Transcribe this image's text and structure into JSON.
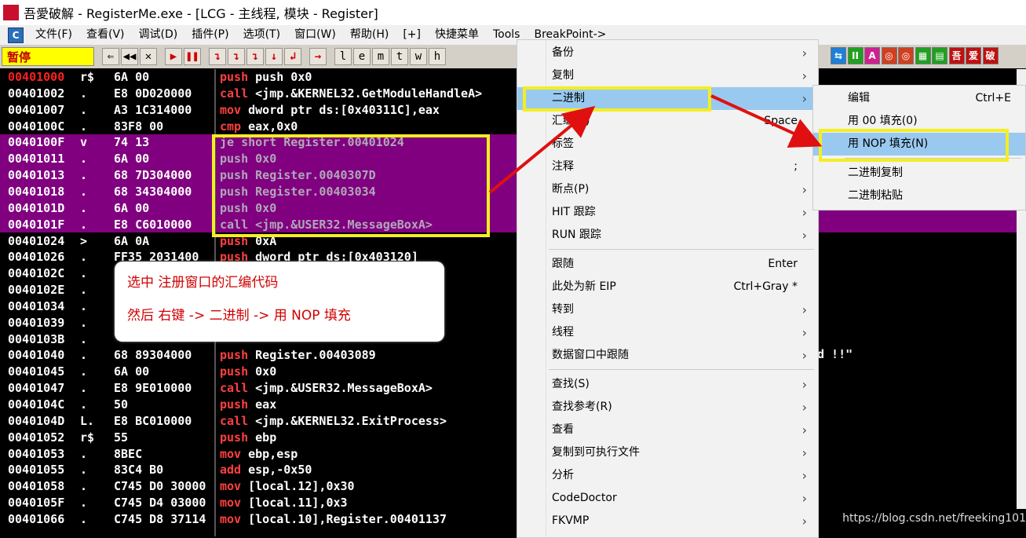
{
  "window": {
    "title": "吾愛破解 - RegisterMe.exe - [LCG -  主线程, 模块 - Register]",
    "logo_text": "吾愛破解"
  },
  "menubar": {
    "items": [
      "文件(F)",
      "查看(V)",
      "调试(D)",
      "插件(P)",
      "选项(T)",
      "窗口(W)",
      "帮助(H)",
      "[+]",
      "快捷菜单",
      "Tools",
      "BreakPoint->"
    ]
  },
  "toolbar": {
    "status": "暂停",
    "buttons": [
      "⇐",
      "◀◀",
      "✕",
      "▶",
      "❚❚",
      "↴",
      "↴",
      "↴",
      "↓",
      "↲",
      "→",
      "l",
      "e",
      "m",
      "t",
      "w",
      "h"
    ],
    "right_buttons": [
      "⇆",
      "II",
      "A",
      "◎",
      "◎",
      "▦",
      "▤",
      "吾",
      "爱",
      "破"
    ]
  },
  "disasm": {
    "rows": [
      {
        "addr": "00401000",
        "marker": "r$",
        "hex": "6A 00",
        "asm": "push 0x0",
        "mn": "push",
        "eip": true,
        "sel": false
      },
      {
        "addr": "00401002",
        "marker": ".",
        "hex": "E8 0D020000",
        "asm": "<jmp.&KERNEL32.GetModuleHandleA>",
        "mn": "call",
        "eip": false,
        "sel": false
      },
      {
        "addr": "00401007",
        "marker": ".",
        "hex": "A3 1C314000",
        "asm": "dword ptr ds:[0x40311C],eax",
        "mn": "mov",
        "eip": false,
        "sel": false
      },
      {
        "addr": "0040100C",
        "marker": ".",
        "hex": "83F8 00",
        "asm": "eax,0x0",
        "mn": "cmp",
        "eip": false,
        "sel": false
      },
      {
        "addr": "0040100F",
        "marker": "v",
        "hex": "74 13",
        "asm": "je short Register.00401024",
        "mn": "",
        "eip": false,
        "sel": true
      },
      {
        "addr": "00401011",
        "marker": ".",
        "hex": "6A 00",
        "asm": "push 0x0",
        "mn": "",
        "eip": false,
        "sel": true
      },
      {
        "addr": "00401013",
        "marker": ".",
        "hex": "68 7D304000",
        "asm": "push Register.0040307D",
        "mn": "",
        "eip": false,
        "sel": true
      },
      {
        "addr": "00401018",
        "marker": ".",
        "hex": "68 34304000",
        "asm": "push Register.00403034",
        "mn": "",
        "eip": false,
        "sel": true
      },
      {
        "addr": "0040101D",
        "marker": ".",
        "hex": "6A 00",
        "asm": "push 0x0",
        "mn": "",
        "eip": false,
        "sel": true
      },
      {
        "addr": "0040101F",
        "marker": ".",
        "hex": "E8 C6010000",
        "asm": "call <jmp.&USER32.MessageBoxA>",
        "mn": "",
        "eip": false,
        "sel": true
      },
      {
        "addr": "00401024",
        "marker": ">",
        "hex": "6A 0A",
        "asm": "0xA",
        "mn": "push",
        "eip": false,
        "sel": false
      },
      {
        "addr": "00401026",
        "marker": ".",
        "hex": "FF35 2031400",
        "asm": "dword ptr ds:[0x403120]",
        "mn": "push",
        "eip": false,
        "sel": false
      },
      {
        "addr": "0040102C",
        "marker": ".",
        "hex": "",
        "asm": "",
        "mn": "",
        "eip": false,
        "sel": false
      },
      {
        "addr": "0040102E",
        "marker": ".",
        "hex": "",
        "asm": "",
        "mn": "",
        "eip": false,
        "sel": false
      },
      {
        "addr": "00401034",
        "marker": ".",
        "hex": "",
        "asm": "",
        "mn": "",
        "eip": false,
        "sel": false
      },
      {
        "addr": "00401039",
        "marker": ".",
        "hex": "",
        "asm": "",
        "mn": "",
        "eip": false,
        "sel": false
      },
      {
        "addr": "0040103B",
        "marker": ".",
        "hex": "",
        "asm": "",
        "mn": "",
        "eip": false,
        "sel": false
      },
      {
        "addr": "00401040",
        "marker": ".",
        "hex": "68 89304000",
        "asm": "Register.00403089",
        "mn": "push",
        "eip": false,
        "sel": false
      },
      {
        "addr": "00401045",
        "marker": ".",
        "hex": "6A 00",
        "asm": "0x0",
        "mn": "push",
        "eip": false,
        "sel": false
      },
      {
        "addr": "00401047",
        "marker": ".",
        "hex": "E8 9E010000",
        "asm": "<jmp.&USER32.MessageBoxA>",
        "mn": "call",
        "eip": false,
        "sel": false
      },
      {
        "addr": "0040104C",
        "marker": ".",
        "hex": "50",
        "asm": "eax",
        "mn": "push",
        "eip": false,
        "sel": false
      },
      {
        "addr": "0040104D",
        "marker": "L.",
        "hex": "E8 BC010000",
        "asm": "<jmp.&KERNEL32.ExitProcess>",
        "mn": "call",
        "eip": false,
        "sel": false
      },
      {
        "addr": "00401052",
        "marker": "r$",
        "hex": "55",
        "asm": "ebp",
        "mn": "push",
        "eip": false,
        "sel": false
      },
      {
        "addr": "00401053",
        "marker": ".",
        "hex": "8BEC",
        "asm": "ebp,esp",
        "mn": "mov",
        "eip": false,
        "sel": false
      },
      {
        "addr": "00401055",
        "marker": ".",
        "hex": "83C4 B0",
        "asm": "esp,-0x50",
        "mn": "add",
        "eip": false,
        "sel": false
      },
      {
        "addr": "00401058",
        "marker": ".",
        "hex": "C745 D0 30000",
        "asm": "[local.12],0x30",
        "mn": "mov",
        "eip": false,
        "sel": false
      },
      {
        "addr": "0040105F",
        "marker": ".",
        "hex": "C745 D4 03000",
        "asm": "[local.11],0x3",
        "mn": "mov",
        "eip": false,
        "sel": false
      },
      {
        "addr": "00401066",
        "marker": ".",
        "hex": "C745 D8 37114",
        "asm": "[local.10],Register.00401137",
        "mn": "mov",
        "eip": false,
        "sel": false
      }
    ],
    "right_fragment": "d !!\""
  },
  "callout": {
    "line1": "选中 注册窗口的汇编代码",
    "line2": "然后 右键 -> 二进制 -> 用 NOP 填充"
  },
  "context_menu": {
    "items": [
      {
        "label": "备份",
        "shortcut": "",
        "arrow": true
      },
      {
        "label": "复制",
        "shortcut": "",
        "arrow": true
      },
      {
        "label": "二进制",
        "shortcut": "",
        "arrow": true,
        "active": true
      },
      {
        "label": "汇编(A)",
        "shortcut": "Space",
        "arrow": false
      },
      {
        "label": "标签",
        "shortcut": ":",
        "arrow": false
      },
      {
        "label": "注释",
        "shortcut": ";",
        "arrow": false
      },
      {
        "label": "断点(P)",
        "shortcut": "",
        "arrow": true
      },
      {
        "label": "HIT 跟踪",
        "shortcut": "",
        "arrow": true
      },
      {
        "label": "RUN 跟踪",
        "shortcut": "",
        "arrow": true
      },
      {
        "label": "跟随",
        "shortcut": "Enter",
        "arrow": false,
        "divider_before": true
      },
      {
        "label": "此处为新 EIP",
        "shortcut": "Ctrl+Gray *",
        "arrow": false
      },
      {
        "label": "转到",
        "shortcut": "",
        "arrow": true
      },
      {
        "label": "线程",
        "shortcut": "",
        "arrow": true
      },
      {
        "label": "数据窗口中跟随",
        "shortcut": "",
        "arrow": true
      },
      {
        "label": "查找(S)",
        "shortcut": "",
        "arrow": true,
        "divider_before": true
      },
      {
        "label": "查找参考(R)",
        "shortcut": "",
        "arrow": true
      },
      {
        "label": "查看",
        "shortcut": "",
        "arrow": true
      },
      {
        "label": "复制到可执行文件",
        "shortcut": "",
        "arrow": true
      },
      {
        "label": "分析",
        "shortcut": "",
        "arrow": true
      },
      {
        "label": "CodeDoctor",
        "shortcut": "",
        "arrow": true
      },
      {
        "label": "FKVMP",
        "shortcut": "",
        "arrow": true
      }
    ]
  },
  "submenu": {
    "items": [
      {
        "label": "编辑",
        "shortcut": "Ctrl+E"
      },
      {
        "label": "用 00 填充(0)",
        "shortcut": ""
      },
      {
        "label": "用 NOP 填充(N)",
        "shortcut": "",
        "active": true
      },
      {
        "label": "二进制复制",
        "shortcut": "",
        "divider_before": true
      },
      {
        "label": "二进制粘贴",
        "shortcut": ""
      }
    ]
  },
  "watermark": "https://blog.csdn.net/freeking101"
}
